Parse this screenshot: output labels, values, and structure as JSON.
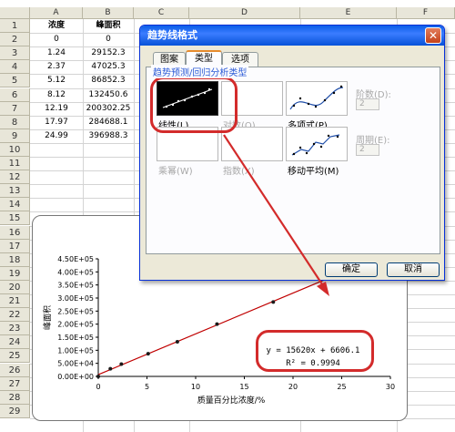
{
  "sheet": {
    "columns": [
      "A",
      "B",
      "C",
      "D",
      "E",
      "F"
    ],
    "rows": [
      "1",
      "2",
      "3",
      "4",
      "5",
      "6",
      "7",
      "8",
      "9",
      "10",
      "11",
      "12",
      "13",
      "14",
      "15",
      "16",
      "17",
      "18",
      "19",
      "20",
      "21",
      "22",
      "23",
      "24",
      "25",
      "26",
      "27",
      "28",
      "29"
    ],
    "headers": {
      "a": "浓度",
      "b": "峰面积"
    },
    "data": [
      {
        "a": "0",
        "b": "0"
      },
      {
        "a": "1.24",
        "b": "29152.3"
      },
      {
        "a": "2.37",
        "b": "47025.3"
      },
      {
        "a": "5.12",
        "b": "86852.3"
      },
      {
        "a": "8.12",
        "b": "132450.6"
      },
      {
        "a": "12.19",
        "b": "200302.25"
      },
      {
        "a": "17.97",
        "b": "284688.1"
      },
      {
        "a": "24.99",
        "b": "396988.3"
      }
    ]
  },
  "dialog": {
    "title": "趋势线格式",
    "close_glyph": "✕",
    "tabs": [
      {
        "label": "图案"
      },
      {
        "label": "类型"
      },
      {
        "label": "选项"
      }
    ],
    "group_label": "趋势预测/回归分析类型",
    "options": [
      {
        "label": "线性(L)"
      },
      {
        "label": "对数(O)"
      },
      {
        "label": "多项式(P)"
      },
      {
        "label": "乘幂(W)"
      },
      {
        "label": "指数(X)"
      },
      {
        "label": "移动平均(M)"
      }
    ],
    "order": {
      "label": "阶数(D):",
      "value": "2"
    },
    "period": {
      "label": "周期(E):",
      "value": "2"
    },
    "ok_label": "确定",
    "cancel_label": "取消"
  },
  "chart_data": {
    "type": "scatter",
    "ylabel": "峰面积",
    "xlabel": "质量百分比浓度/%",
    "xlim": [
      0,
      30
    ],
    "ylim": [
      0,
      450000
    ],
    "x_ticks": [
      "0",
      "5",
      "10",
      "15",
      "20",
      "25",
      "30"
    ],
    "y_ticks": [
      "0.00E+00",
      "5.00E+04",
      "1.00E+05",
      "1.50E+05",
      "2.00E+05",
      "2.50E+05",
      "3.00E+05",
      "3.50E+05",
      "4.00E+05",
      "4.50E+05"
    ],
    "series": [
      {
        "x": [
          0,
          1.24,
          2.37,
          5.12,
          8.12,
          12.19,
          17.97,
          24.99
        ],
        "y": [
          0,
          29152.3,
          47025.3,
          86852.3,
          132450.6,
          200302.25,
          284688.1,
          396988.3
        ]
      }
    ],
    "trendline": {
      "slope": 15620,
      "intercept": 6606.1
    },
    "equation": "y = 15620x + 6606.1",
    "r2": "R² = 0.9994",
    "marker_color": "#1a1a1a",
    "line_color": "#c00000"
  },
  "colors": {
    "annotation": "#d32b2b"
  }
}
